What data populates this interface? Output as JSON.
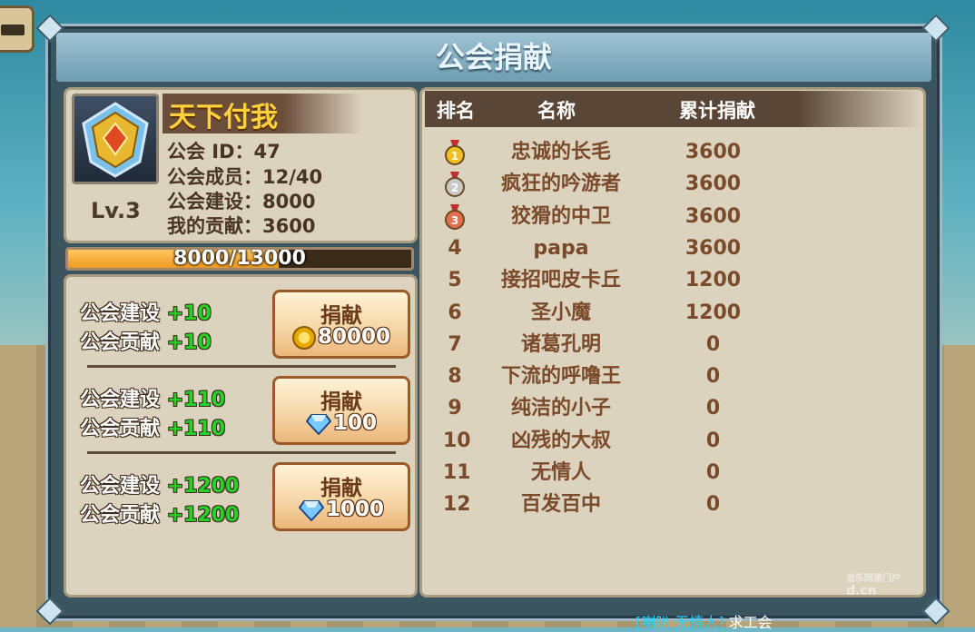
{
  "title": "公会捐献",
  "guild": {
    "name": "天下付我",
    "level": "Lv.3",
    "id_line": "公会  ID：47",
    "members_line": "公会成员：12/40",
    "build_line": "公会建设：8000",
    "my_contrib_line": "我的贡献：3600"
  },
  "progress": {
    "text": "8000/13000",
    "fraction": 0.615
  },
  "donations": [
    {
      "build_label": "公会建设",
      "build_plus": "+10",
      "contrib_label": "公会贡献",
      "contrib_plus": "+10",
      "button_label": "捐献",
      "cost": "80000",
      "currency_icon": "gold-coin-icon"
    },
    {
      "build_label": "公会建设",
      "build_plus": "+110",
      "contrib_label": "公会贡献",
      "contrib_plus": "+110",
      "button_label": "捐献",
      "cost": "100",
      "currency_icon": "diamond-icon"
    },
    {
      "build_label": "公会建设",
      "build_plus": "+1200",
      "contrib_label": "公会贡献",
      "contrib_plus": "+1200",
      "button_label": "捐献",
      "cost": "1000",
      "currency_icon": "diamond-icon"
    }
  ],
  "ranking": {
    "headers": {
      "rank": "排名",
      "name": "名称",
      "total": "累计捐献"
    },
    "rows": [
      {
        "rank": "1",
        "medal": "gold-medal-icon",
        "name": "忠诚的长毛",
        "value": "3600"
      },
      {
        "rank": "2",
        "medal": "silver-medal-icon",
        "name": "疯狂的吟游者",
        "value": "3600"
      },
      {
        "rank": "3",
        "medal": "bronze-medal-icon",
        "name": "狡猾的中卫",
        "value": "3600"
      },
      {
        "rank": "4",
        "name": "papa",
        "value": "3600"
      },
      {
        "rank": "5",
        "name": "接招吧皮卡丘",
        "value": "1200"
      },
      {
        "rank": "6",
        "name": "圣小魔",
        "value": "1200"
      },
      {
        "rank": "7",
        "name": "诸葛孔明",
        "value": "0"
      },
      {
        "rank": "8",
        "name": "下流的呼噜王",
        "value": "0"
      },
      {
        "rank": "9",
        "name": "纯洁的小子",
        "value": "0"
      },
      {
        "rank": "10",
        "name": "凶残的大叔",
        "value": "0"
      },
      {
        "rank": "11",
        "name": "无情人",
        "value": "0"
      },
      {
        "rank": "12",
        "name": "百发百中",
        "value": "0"
      }
    ]
  },
  "chat": {
    "prefix": "[喇叭 无情人]",
    "message": " 求工会"
  },
  "watermark": {
    "small": "当乐网游门户",
    "large": "d.cn"
  },
  "colors": {
    "gold": "#ffd23c",
    "plus_green": "#28d02a",
    "rank_text": "#7a4a2a",
    "frame": "#3b5560"
  }
}
